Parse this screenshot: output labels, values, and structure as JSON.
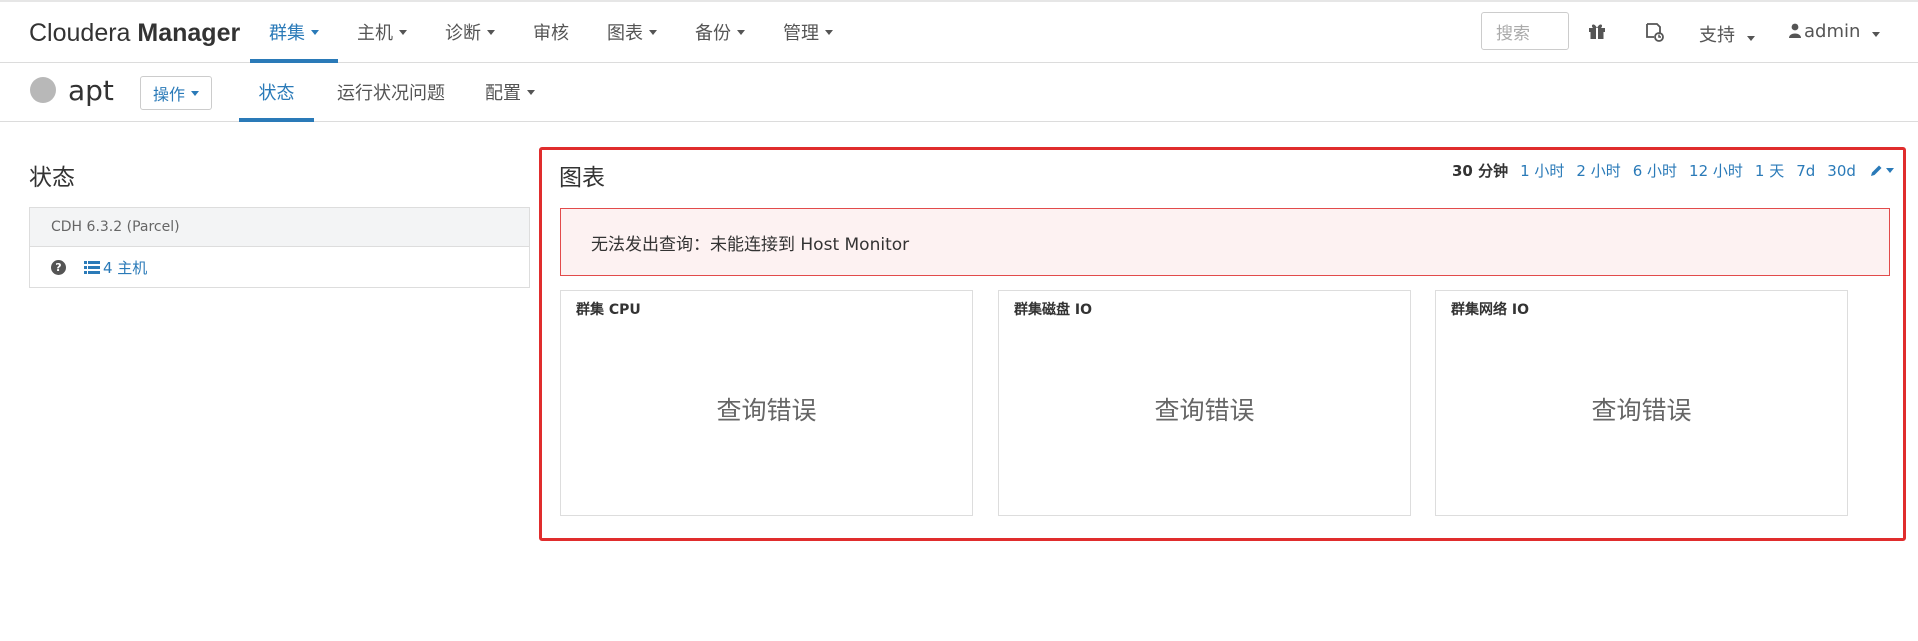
{
  "brand": {
    "light": "Cloudera",
    "bold": "Manager"
  },
  "nav": {
    "items": [
      {
        "label": "群集",
        "caret": true,
        "active": true
      },
      {
        "label": "主机",
        "caret": true
      },
      {
        "label": "诊断",
        "caret": true
      },
      {
        "label": "审核",
        "caret": false
      },
      {
        "label": "图表",
        "caret": true
      },
      {
        "label": "备份",
        "caret": true
      },
      {
        "label": "管理",
        "caret": true
      }
    ],
    "search_placeholder": "搜索",
    "support_label": "支持",
    "user_label": "admin"
  },
  "service": {
    "name": "apt",
    "actions_label": "操作",
    "tabs": [
      {
        "label": "状态",
        "active": true
      },
      {
        "label": "运行状况问题"
      },
      {
        "label": "配置",
        "caret": true
      }
    ]
  },
  "status": {
    "title": "状态",
    "cluster_version": "CDH 6.3.2 (Parcel)",
    "hosts_label": "4 主机"
  },
  "charts": {
    "title": "图表",
    "time_ranges": [
      "30 分钟",
      "1 小时",
      "2 小时",
      "6 小时",
      "12 小时",
      "1 天",
      "7d",
      "30d"
    ],
    "selected_range": "30 分钟",
    "error_message": "无法发出查询：未能连接到 Host Monitor",
    "cards": [
      {
        "title": "群集 CPU",
        "message": "查询错误"
      },
      {
        "title": "群集磁盘 IO",
        "message": "查询错误"
      },
      {
        "title": "群集网络 IO",
        "message": "查询错误"
      }
    ]
  },
  "colors": {
    "accent": "#2a7ab8",
    "highlight_border": "#e02d2d",
    "alert_bg": "#fdf2f2",
    "status_unknown": "#b8b8b8"
  }
}
